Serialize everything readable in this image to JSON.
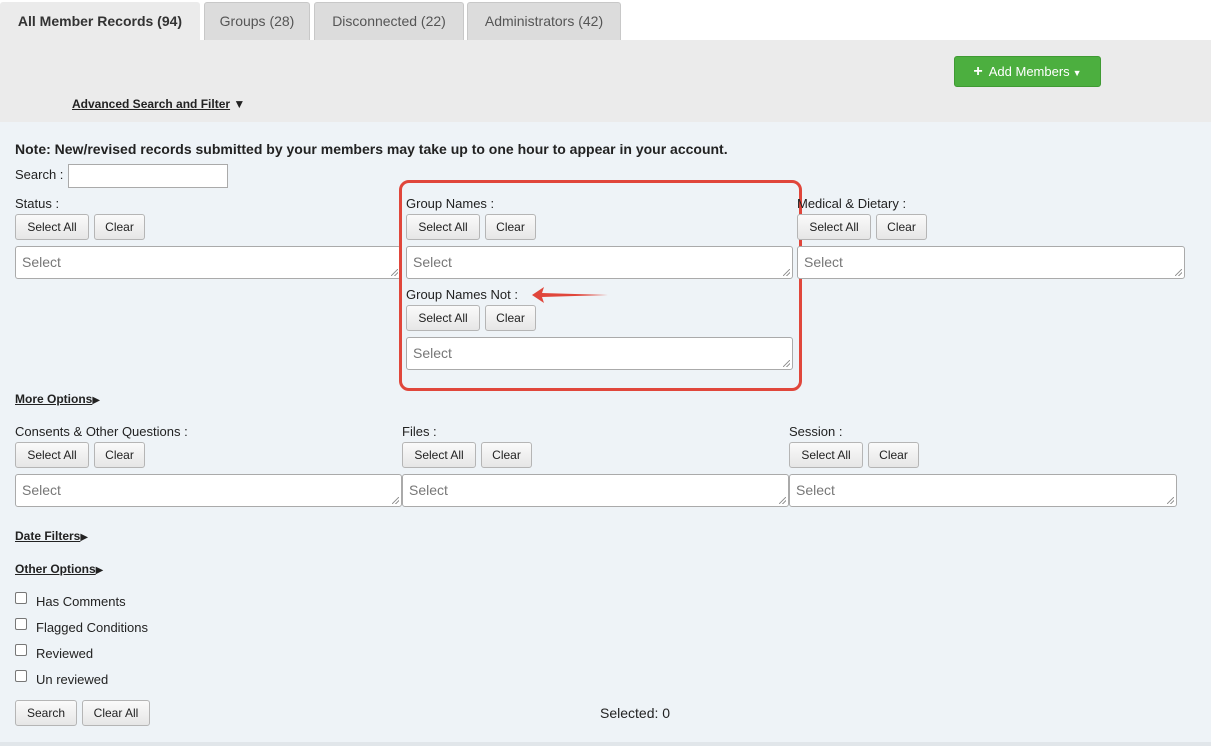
{
  "tabs": [
    {
      "label": "All Member Records (94)"
    },
    {
      "label": "Groups (28)"
    },
    {
      "label": "Disconnected (22)"
    },
    {
      "label": "Administrators (42)"
    }
  ],
  "toolbar": {
    "add_members_label": "Add Members"
  },
  "advanced": {
    "label": "Advanced Search and Filter",
    "arrow": "▼"
  },
  "note": "Note: New/revised records submitted by your members may take up to one hour to appear in your account.",
  "search": {
    "label": "Search :",
    "value": ""
  },
  "buttons": {
    "select_all": "Select All",
    "clear": "Clear"
  },
  "filters": {
    "status": {
      "label": "Status :",
      "placeholder": "Select"
    },
    "group_names": {
      "label": "Group Names :",
      "placeholder": "Select"
    },
    "group_names_not": {
      "label": "Group Names Not :",
      "placeholder": "Select"
    },
    "medical_dietary": {
      "label": "Medical & Dietary :",
      "placeholder": "Select"
    },
    "consents": {
      "label": "Consents & Other Questions :",
      "placeholder": "Select"
    },
    "files": {
      "label": "Files :",
      "placeholder": "Select"
    },
    "session": {
      "label": "Session :",
      "placeholder": "Select"
    }
  },
  "sections": {
    "more_options": "More Options",
    "date_filters": "Date Filters",
    "other_options": "Other Options",
    "arrow": "▶"
  },
  "checkboxes": [
    {
      "label": "Has Comments",
      "checked": false
    },
    {
      "label": "Flagged Conditions",
      "checked": false
    },
    {
      "label": "Reviewed",
      "checked": false
    },
    {
      "label": "Un reviewed",
      "checked": false
    }
  ],
  "footer": {
    "search_label": "Search",
    "clear_all_label": "Clear All",
    "selected": "Selected: 0"
  },
  "colors": {
    "accent_green": "#4caf3f",
    "highlight_red": "#e0463b"
  }
}
